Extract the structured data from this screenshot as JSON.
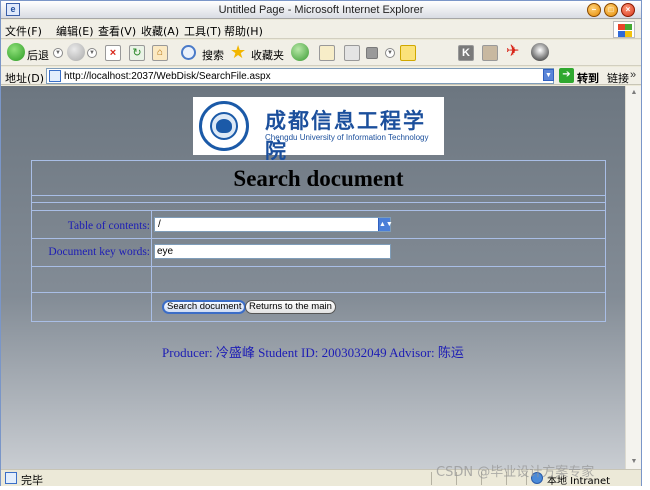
{
  "window": {
    "title": "Untitled Page - Microsoft Internet Explorer",
    "icon": "ie-page-icon"
  },
  "menu": {
    "items": [
      "文件(F)",
      "编辑(E)",
      "查看(V)",
      "收藏(A)",
      "工具(T)",
      "帮助(H)"
    ]
  },
  "toolbar": {
    "back_label": "后退",
    "search_label": "搜索",
    "favorites_label": "收藏夹"
  },
  "address": {
    "label": "地址(D)",
    "url": "http://localhost:2037/WebDisk/SearchFile.aspx",
    "go_label": "转到",
    "links_label": "链接"
  },
  "logo": {
    "cn_name": "成都信息工程学院",
    "en_name": "Chengdu University of Information Technology"
  },
  "form": {
    "title": "Search document",
    "directory_label": "Table of contents:",
    "directory_value": "/",
    "keyword_label": "Document key words:",
    "keyword_value": "eye",
    "search_button": "Search document",
    "back_button": "Returns to the main"
  },
  "credits": "Producer: 冷盛峰  Student ID: 2003032049  Advisor: 陈运",
  "status": {
    "text": "完毕",
    "zone": "本地 Intranet"
  },
  "watermark": "CSDN @毕业设计方案专家",
  "colors": {
    "label_blue": "#1d1db5",
    "table_border": "#a9bee6",
    "page_bg_top": "#6c7680",
    "page_bg_bottom": "#c9cdd2"
  }
}
